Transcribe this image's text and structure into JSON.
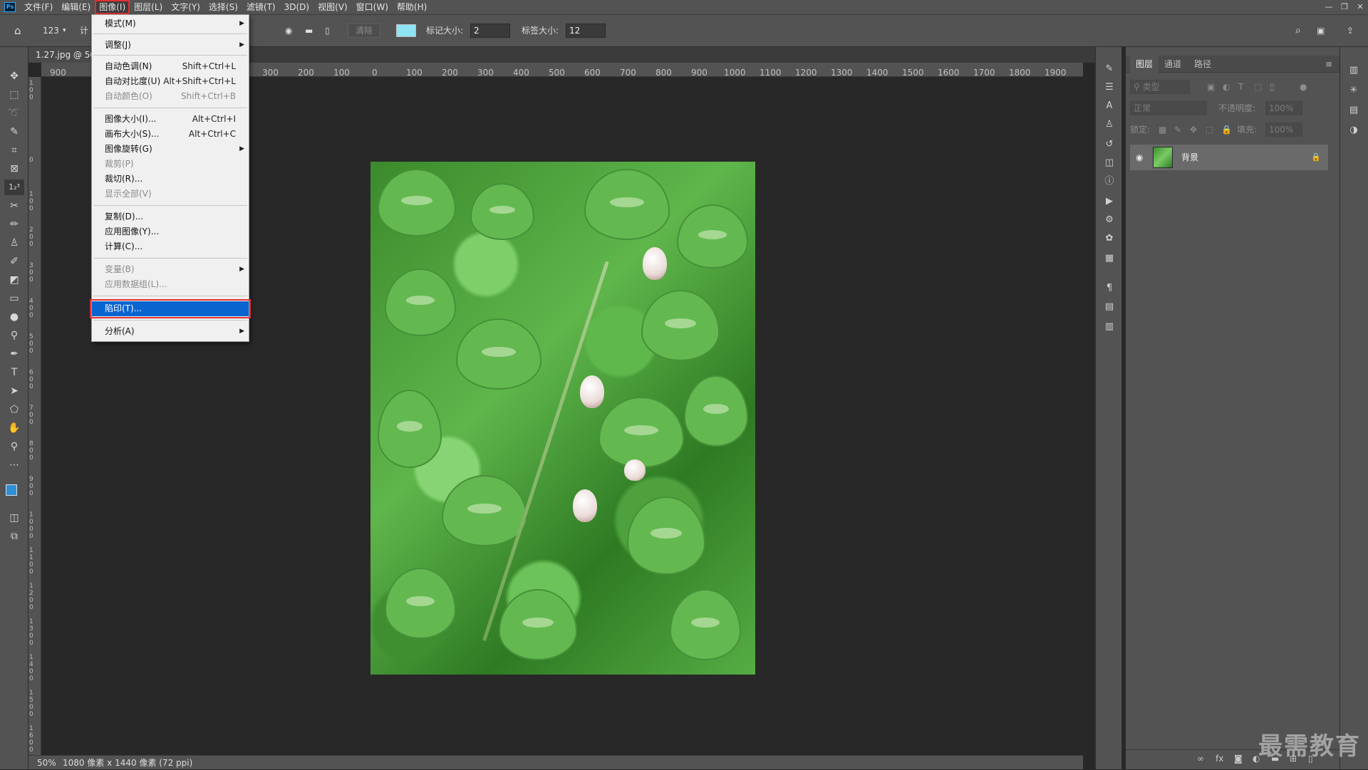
{
  "menubar": {
    "logo": "Ps",
    "items": [
      "文件(F)",
      "编辑(E)",
      "图像(I)",
      "图层(L)",
      "文字(Y)",
      "选择(S)",
      "滤镜(T)",
      "3D(D)",
      "视图(V)",
      "窗口(W)",
      "帮助(H)"
    ],
    "window_controls": [
      "—",
      "❐",
      "✕"
    ]
  },
  "options": {
    "tool_label": "123",
    "calc_label": "计",
    "clear_label": "清除",
    "marker_size_label": "标记大小:",
    "marker_size_value": "2",
    "label_size_label": "标签大小:",
    "label_size_value": "12",
    "swatch_color": "#8fe3f2"
  },
  "document": {
    "tab_title": "1.27.jpg @ 50"
  },
  "ruler_top": {
    "labels": [
      "900",
      "300",
      "200",
      "100",
      "0",
      "100",
      "200",
      "300",
      "400",
      "500",
      "600",
      "700",
      "800",
      "900",
      "1000",
      "1100",
      "1200",
      "1300",
      "1400",
      "1500",
      "1600",
      "1700",
      "1800",
      "1900"
    ]
  },
  "ruler_left": {
    "labels": [
      "100",
      "0",
      "100",
      "200",
      "300",
      "400",
      "500",
      "600",
      "700",
      "800",
      "900",
      "1000",
      "1100",
      "1200",
      "1300",
      "1400",
      "1500",
      "1600"
    ]
  },
  "status": {
    "zoom": "50%",
    "info": "1080 像素 x 1440 像素 (72 ppi)"
  },
  "image_menu": {
    "items": [
      {
        "label": "模式(M)",
        "shortcut": "",
        "submenu": true,
        "disabled": false
      },
      {
        "label": "调整(J)",
        "shortcut": "",
        "submenu": true,
        "disabled": false
      },
      {
        "label": "自动色调(N)",
        "shortcut": "Shift+Ctrl+L",
        "submenu": false,
        "disabled": false
      },
      {
        "label": "自动对比度(U)",
        "shortcut": "Alt+Shift+Ctrl+L",
        "submenu": false,
        "disabled": false
      },
      {
        "label": "自动颜色(O)",
        "shortcut": "Shift+Ctrl+B",
        "submenu": false,
        "disabled": true
      },
      {
        "label": "图像大小(I)...",
        "shortcut": "Alt+Ctrl+I",
        "submenu": false,
        "disabled": false
      },
      {
        "label": "画布大小(S)...",
        "shortcut": "Alt+Ctrl+C",
        "submenu": false,
        "disabled": false
      },
      {
        "label": "图像旋转(G)",
        "shortcut": "",
        "submenu": true,
        "disabled": false
      },
      {
        "label": "裁剪(P)",
        "shortcut": "",
        "submenu": false,
        "disabled": true
      },
      {
        "label": "裁切(R)...",
        "shortcut": "",
        "submenu": false,
        "disabled": false
      },
      {
        "label": "显示全部(V)",
        "shortcut": "",
        "submenu": false,
        "disabled": true
      },
      {
        "label": "复制(D)...",
        "shortcut": "",
        "submenu": false,
        "disabled": false
      },
      {
        "label": "应用图像(Y)...",
        "shortcut": "",
        "submenu": false,
        "disabled": false
      },
      {
        "label": "计算(C)...",
        "shortcut": "",
        "submenu": false,
        "disabled": false
      },
      {
        "label": "变量(B)",
        "shortcut": "",
        "submenu": true,
        "disabled": true
      },
      {
        "label": "应用数据组(L)...",
        "shortcut": "",
        "submenu": false,
        "disabled": true
      },
      {
        "label": "陷印(T)...",
        "shortcut": "",
        "submenu": false,
        "disabled": false
      },
      {
        "label": "分析(A)",
        "shortcut": "",
        "submenu": true,
        "disabled": false
      }
    ]
  },
  "layers_panel": {
    "tabs": [
      "图层",
      "通道",
      "路径"
    ],
    "filter_placeholder": "类型",
    "blend_mode": "正常",
    "opacity_label": "不透明度:",
    "opacity_value": "100%",
    "lock_label": "锁定:",
    "fill_label": "填充:",
    "fill_value": "100%",
    "layer_name": "背景"
  },
  "watermark": "最需教育"
}
